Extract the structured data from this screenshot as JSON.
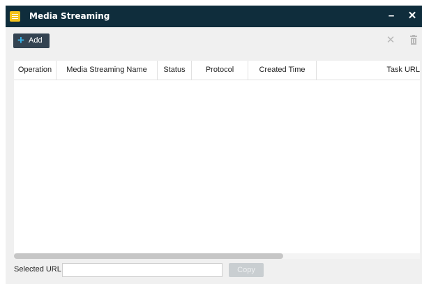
{
  "window": {
    "title": "Media Streaming",
    "minimize_glyph": "–",
    "close_glyph": "✕"
  },
  "toolbar": {
    "add_label": "Add",
    "add_icon": "plus-icon",
    "cancel_icon": "close-icon",
    "delete_icon": "trash-icon"
  },
  "table": {
    "columns": [
      "Operation",
      "Media Streaming Name",
      "Status",
      "Protocol",
      "Created Time",
      "Task URL"
    ],
    "rows": []
  },
  "footer": {
    "selected_url_label": "Selected URL",
    "selected_url_value": "",
    "copy_label": "Copy"
  },
  "colors": {
    "titlebar": "#0f2d3c",
    "accent": "#37b1e6",
    "icon_yellow": "#f4c21b"
  }
}
